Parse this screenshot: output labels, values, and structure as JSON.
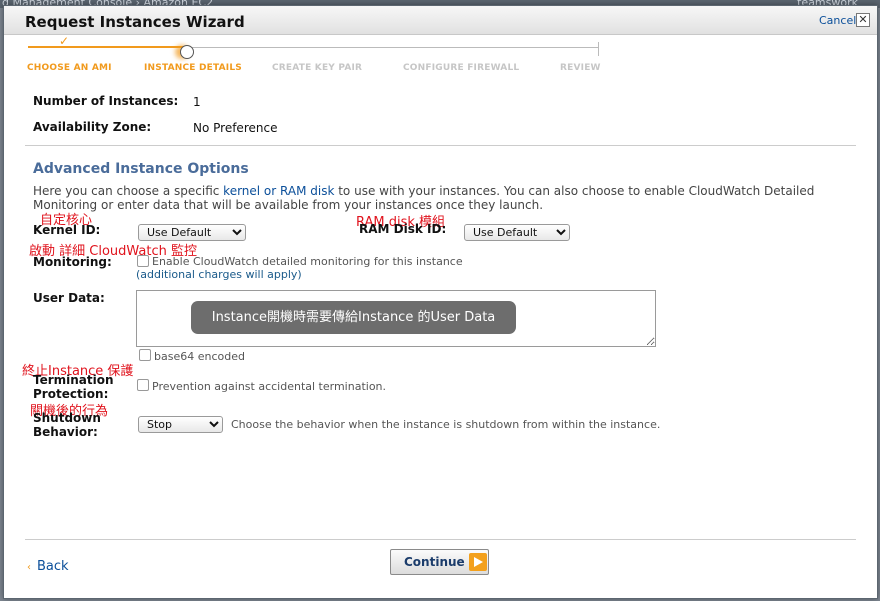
{
  "background": {
    "left_text": "d Management Console › Amazon EC2",
    "right_text": "teamswork"
  },
  "dialog": {
    "title": "Request Instances Wizard",
    "cancel_label": "Cancel",
    "close_symbol": "✕"
  },
  "steps": [
    {
      "label": "CHOOSE AN AMI",
      "state": "done"
    },
    {
      "label": "INSTANCE DETAILS",
      "state": "active"
    },
    {
      "label": "CREATE KEY PAIR",
      "state": "future"
    },
    {
      "label": "CONFIGURE FIREWALL",
      "state": "future"
    },
    {
      "label": "REVIEW",
      "state": "future"
    }
  ],
  "fields": {
    "num_instances_label": "Number of Instances:",
    "num_instances_value": "1",
    "az_label": "Availability Zone:",
    "az_value": "No Preference"
  },
  "advanced": {
    "title": "Advanced Instance Options",
    "desc_before": "Here you can choose a specific ",
    "desc_link": "kernel or RAM disk",
    "desc_after": " to use with your instances. You can also choose to enable CloudWatch Detailed Monitoring or enter data that will be available from your instances once they launch.",
    "kernel_label": "Kernel ID:",
    "kernel_value": "Use Default",
    "ramdisk_label": "RAM Disk ID:",
    "ramdisk_value": "Use Default",
    "monitoring_label": "Monitoring:",
    "monitoring_checkbox": "Enable CloudWatch detailed monitoring for this instance",
    "monitoring_note": "(additional charges will apply)",
    "userdata_label": "User Data:",
    "userdata_value": "",
    "base64_label": "base64 encoded",
    "termination_label_1": "Termination",
    "termination_label_2": "Protection:",
    "termination_checkbox": "Prevention against accidental termination.",
    "shutdown_label_1": "Shutdown",
    "shutdown_label_2": "Behavior:",
    "shutdown_value": "Stop",
    "shutdown_desc": "Choose the behavior when the instance is shutdown from within the instance."
  },
  "annotations": {
    "kernel": "自定核心",
    "ramdisk": "RAM disk 模組",
    "monitoring": "啟動 詳細 CloudWatch 監控",
    "userdata_tooltip": "Instance開機時需要傳給Instance 的User Data",
    "termination": "終止Instance 保護",
    "shutdown": "關機後的行為"
  },
  "footer": {
    "back_label": "Back",
    "continue_label": "Continue"
  },
  "colors": {
    "accent_orange": "#f19a1d",
    "link_blue": "#0b4f9a",
    "section_blue": "#4a6c9a",
    "annotation_red": "#e0131d"
  }
}
